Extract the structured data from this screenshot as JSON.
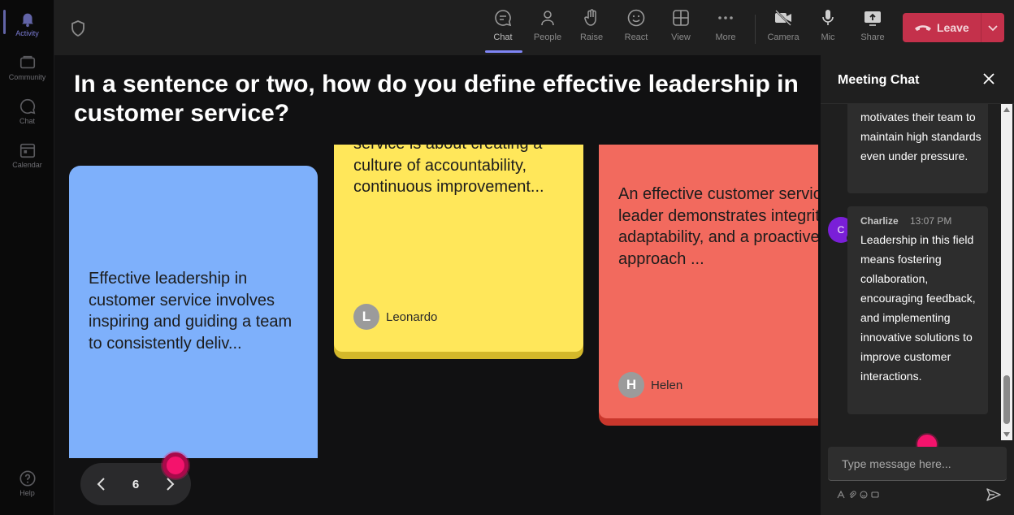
{
  "rail": {
    "items": [
      {
        "label": "Activity"
      },
      {
        "label": "Community"
      },
      {
        "label": "Chat"
      },
      {
        "label": "Calendar"
      },
      {
        "label": "Help"
      }
    ]
  },
  "toolbar": {
    "items": [
      {
        "label": "Chat",
        "icon": "chat-icon"
      },
      {
        "label": "People",
        "icon": "people-icon"
      },
      {
        "label": "Raise",
        "icon": "raise-hand-icon"
      },
      {
        "label": "React",
        "icon": "react-icon"
      },
      {
        "label": "View",
        "icon": "view-icon"
      },
      {
        "label": "More",
        "icon": "more-icon"
      },
      {
        "label": "Camera",
        "icon": "camera-icon"
      },
      {
        "label": "Mic",
        "icon": "mic-icon"
      },
      {
        "label": "Share",
        "icon": "share-icon"
      }
    ],
    "leave_label": "Leave",
    "leave_color": "#c4314b"
  },
  "board": {
    "question": "In a sentence or two, how do you define effective leadership in customer service?",
    "cards": [
      {
        "text": "Effective leadership in customer service involves inspiring and guiding a team to consistently deliv...",
        "color": "#7eb0fb"
      },
      {
        "text": "service is about creating a culture of accountability, continuous improvement...",
        "author": "Leonardo",
        "initial": "L",
        "color": "#ffe75a"
      },
      {
        "text": "An effective customer service leader demonstrates integrity, adaptability, and a proactive approach ...",
        "author": "Helen",
        "initial": "H",
        "color": "#f26a5e"
      }
    ],
    "page": "6"
  },
  "chat": {
    "title": "Meeting Chat",
    "messages": [
      {
        "text": "motivates their team to maintain high standards even under pressure."
      },
      {
        "sender": "Charlize",
        "initial": "C",
        "time": "13:07 PM",
        "text": "Leadership in this field means fostering collaboration, encouraging feedback, and implementing innovative solutions to improve customer interactions."
      }
    ],
    "placeholder": "Type message here..."
  }
}
